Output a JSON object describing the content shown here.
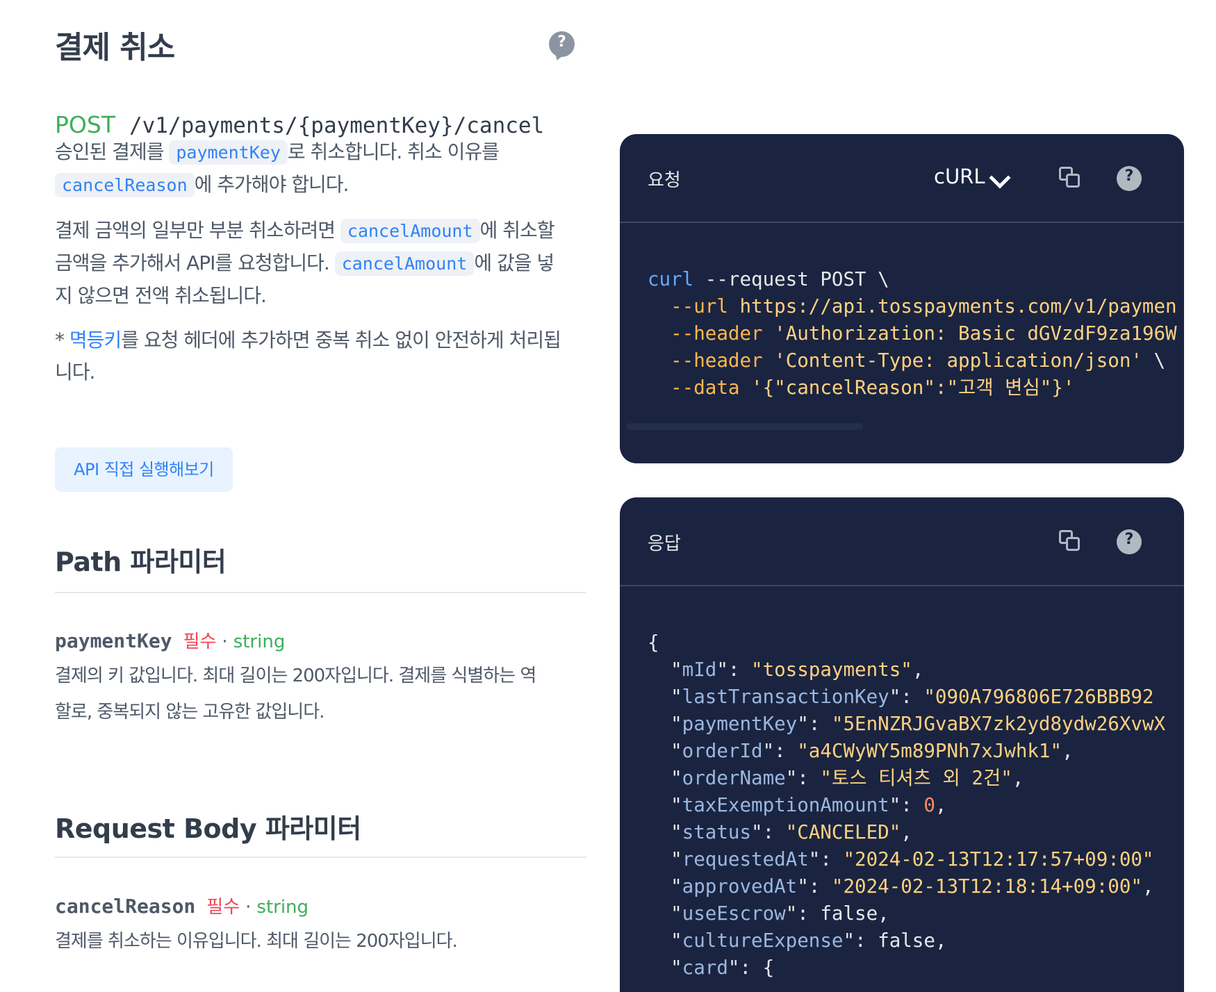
{
  "page": {
    "title": "결제 취소",
    "endpoint": {
      "method": "POST",
      "path": "/v1/payments/{paymentKey}/cancel"
    },
    "desc1": {
      "t1": "승인된 결제를 ",
      "c1": "paymentKey",
      "t2": "로 취소합니다. 취소 이유를 ",
      "c2": "cancelReason",
      "t3": "에 추가해야 합니다."
    },
    "desc2": {
      "t1": "결제 금액의 일부만 부분 취소하려면 ",
      "c1": "cancelAmount",
      "t2": "에 취소할 금액을 추가해서 API를 요청합니다. ",
      "c2": "cancelAmount",
      "t3": "에 값을 넣지 않으면 전액 취소됩니다."
    },
    "desc3": {
      "t1": "* ",
      "link": "멱등키",
      "t2": "를 요청 헤더에 추가하면 중복 취소 없이 안전하게 처리됩니다."
    },
    "try_button": "API 직접 실행해보기",
    "path_params": {
      "heading": "Path 파라미터",
      "items": [
        {
          "name": "paymentKey",
          "required": "필수",
          "sep": "·",
          "type": "string",
          "desc": "결제의 키 값입니다. 최대 길이는 200자입니다. 결제를 식별하는 역할로, 중복되지 않는 고유한 값입니다."
        }
      ]
    },
    "body_params": {
      "heading": "Request Body 파라미터",
      "items": [
        {
          "name": "cancelReason",
          "required": "필수",
          "sep": "·",
          "type": "string",
          "desc": "결제를 취소하는 이유입니다. 최대 길이는 200자입니다."
        }
      ]
    }
  },
  "request_panel": {
    "title": "요청",
    "language": "cURL",
    "code": [
      {
        "cmd": "curl",
        "rest": " --request POST \\"
      },
      {
        "flag": "  --url",
        "str": " https://api.tosspayments.com/v1/paymen"
      },
      {
        "flag": "  --header",
        "str": " 'Authorization: Basic dGVzdF9za196W"
      },
      {
        "flag": "  --header",
        "str": " 'Content-Type: application/json'",
        "rest": " \\"
      },
      {
        "flag": "  --data",
        "str": " '{\"cancelReason\":\"고객 변심\"}'"
      }
    ]
  },
  "response_panel": {
    "title": "응답",
    "json": [
      {
        "punc": "{"
      },
      {
        "key": "mId",
        "val": "\"tosspayments\"",
        "kind": "str",
        "end": ","
      },
      {
        "key": "lastTransactionKey",
        "val": "\"090A796806E726BBB92",
        "kind": "str",
        "end": ""
      },
      {
        "key": "paymentKey",
        "val": "\"5EnNZRJGvaBX7zk2yd8ydw26XvwX",
        "kind": "str",
        "end": ""
      },
      {
        "key": "orderId",
        "val": "\"a4CWyWY5m89PNh7xJwhk1\"",
        "kind": "str",
        "end": ","
      },
      {
        "key": "orderName",
        "val": "\"토스 티셔츠 외 2건\"",
        "kind": "str",
        "end": ","
      },
      {
        "key": "taxExemptionAmount",
        "val": "0",
        "kind": "num",
        "end": ","
      },
      {
        "key": "status",
        "val": "\"CANCELED\"",
        "kind": "str",
        "end": ","
      },
      {
        "key": "requestedAt",
        "val": "\"2024-02-13T12:17:57+09:00\"",
        "kind": "str",
        "end": ""
      },
      {
        "key": "approvedAt",
        "val": "\"2024-02-13T12:18:14+09:00\"",
        "kind": "str",
        "end": ","
      },
      {
        "key": "useEscrow",
        "val": "false",
        "kind": "bool",
        "end": ","
      },
      {
        "key": "cultureExpense",
        "val": "false",
        "kind": "bool",
        "end": ","
      },
      {
        "key": "card",
        "val": "{",
        "kind": "punc",
        "end": ""
      }
    ]
  }
}
